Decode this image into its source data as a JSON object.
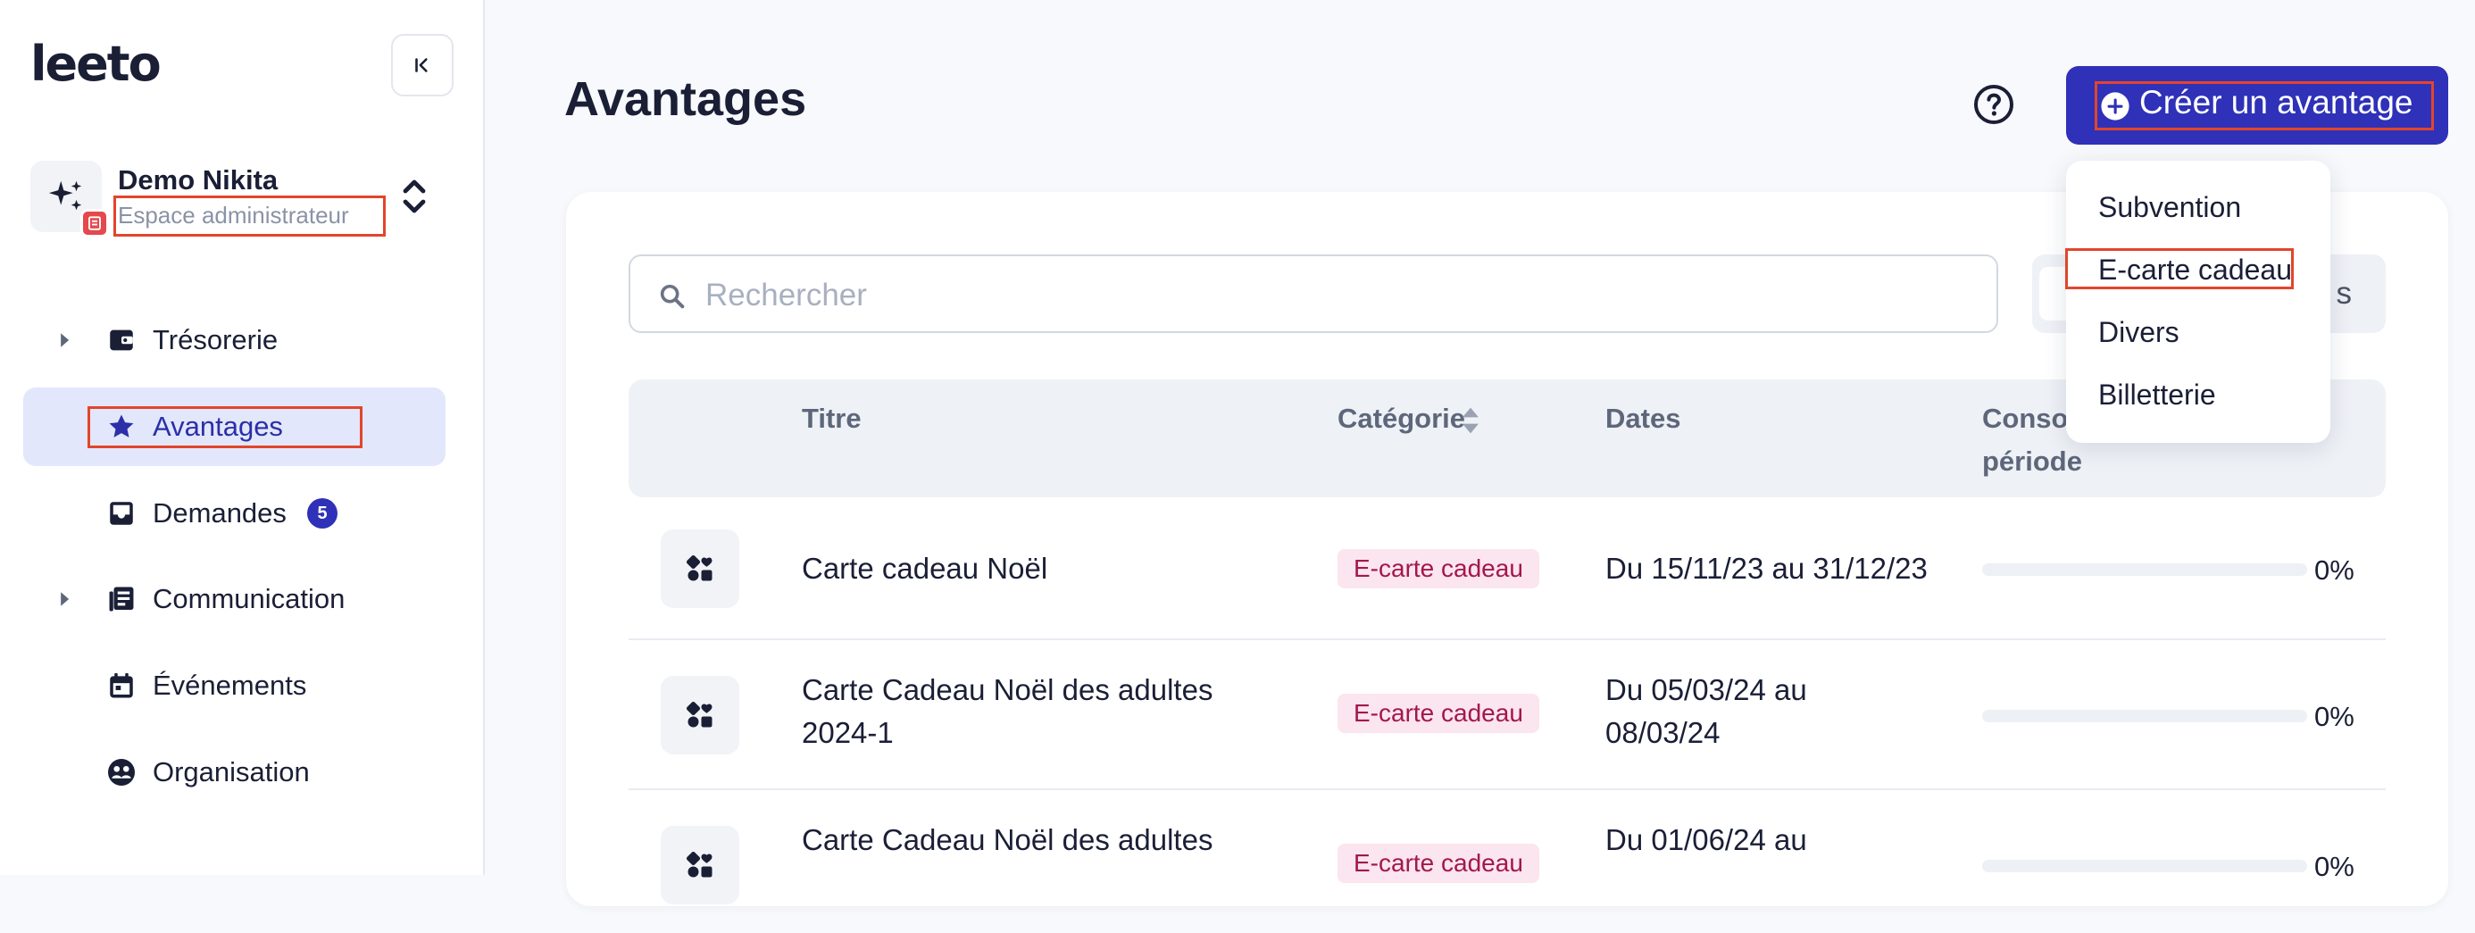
{
  "sidebar": {
    "logo": "leeto",
    "workspace": {
      "name": "Demo Nikita",
      "role": "Espace administrateur"
    },
    "items": [
      {
        "label": "Trésorerie",
        "icon": "wallet-icon",
        "expandable": true
      },
      {
        "label": "Avantages",
        "icon": "star-icon",
        "active": true
      },
      {
        "label": "Demandes",
        "icon": "inbox-icon",
        "count": "5"
      },
      {
        "label": "Communication",
        "icon": "newspaper-icon",
        "expandable": true
      },
      {
        "label": "Événements",
        "icon": "calendar-icon"
      },
      {
        "label": "Organisation",
        "icon": "team-icon"
      }
    ]
  },
  "header": {
    "title": "Avantages",
    "create_label": "Créer un avantage"
  },
  "dropdown": {
    "items": [
      "Subvention",
      "E-carte cadeau",
      "Divers",
      "Billetterie"
    ]
  },
  "search": {
    "placeholder": "Rechercher"
  },
  "filter": {
    "label_tail": "s"
  },
  "table": {
    "columns": {
      "title": "Titre",
      "category": "Catégorie",
      "dates": "Dates",
      "consumption_line1": "Conso",
      "consumption_line2": "période"
    },
    "rows": [
      {
        "title": "Carte cadeau Noël",
        "category": "E-carte cadeau",
        "dates": "Du 15/11/23 au 31/12/23",
        "progress": 0,
        "percent": "0%"
      },
      {
        "title": "Carte Cadeau Noël des adultes 2024-1",
        "category": "E-carte cadeau",
        "dates": "Du 05/03/24 au 08/03/24",
        "progress": 0,
        "percent": "0%"
      },
      {
        "title": "Carte Cadeau Noël des adultes",
        "category": "E-carte cadeau",
        "dates": "Du 01/06/24 au",
        "progress": 0,
        "percent": "0%"
      }
    ]
  },
  "colors": {
    "primary": "#2f31b8",
    "highlight": "#e2452c",
    "tag_bg": "#fbe5ee",
    "tag_text": "#a2184b"
  }
}
